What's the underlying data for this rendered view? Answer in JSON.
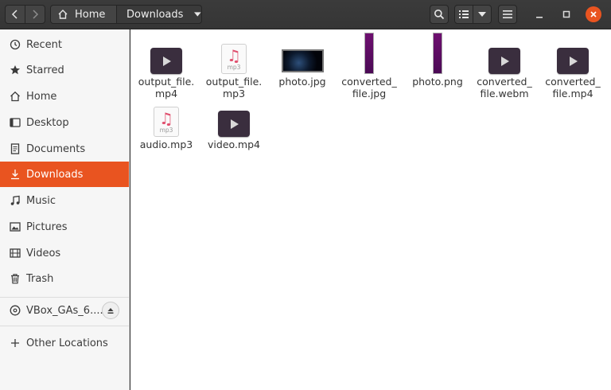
{
  "headerbar": {
    "path": [
      {
        "label": "Home",
        "icon": "home-icon"
      },
      {
        "label": "Downloads",
        "icon": "chevron-down-icon"
      }
    ],
    "buttons": [
      "back",
      "forward",
      "search",
      "list-view",
      "view-options",
      "menu",
      "minimize",
      "maximize",
      "close"
    ]
  },
  "sidebar": {
    "items": [
      {
        "label": "Recent",
        "icon": "clock-icon"
      },
      {
        "label": "Starred",
        "icon": "star-icon"
      },
      {
        "label": "Home",
        "icon": "home-icon"
      },
      {
        "label": "Desktop",
        "icon": "desktop-icon"
      },
      {
        "label": "Documents",
        "icon": "documents-icon"
      },
      {
        "label": "Downloads",
        "icon": "download-icon",
        "active": true
      },
      {
        "label": "Music",
        "icon": "music-icon"
      },
      {
        "label": "Pictures",
        "icon": "pictures-icon"
      },
      {
        "label": "Videos",
        "icon": "videos-icon"
      },
      {
        "label": "Trash",
        "icon": "trash-icon"
      }
    ],
    "device": {
      "label": "VBox_GAs_6....",
      "icon": "disc-icon"
    },
    "other": {
      "label": "Other Locations",
      "icon": "plus-icon"
    }
  },
  "files": [
    {
      "name": "output_file.\nmp4",
      "type": "video"
    },
    {
      "name": "output_file.\nmp3",
      "type": "audio",
      "badge": "mp3"
    },
    {
      "name": "photo.jpg",
      "type": "photo"
    },
    {
      "name": "converted_\nfile.jpg",
      "type": "bar"
    },
    {
      "name": "photo.png",
      "type": "bar"
    },
    {
      "name": "converted_\nfile.webm",
      "type": "video"
    },
    {
      "name": "converted_\nfile.mp4",
      "type": "video"
    },
    {
      "name": "audio.mp3",
      "type": "audio",
      "badge": "mp3"
    },
    {
      "name": "video.mp4",
      "type": "video"
    }
  ],
  "colors": {
    "accent": "#e95420",
    "header": "#383838",
    "sidebar": "#f6f6f6"
  }
}
